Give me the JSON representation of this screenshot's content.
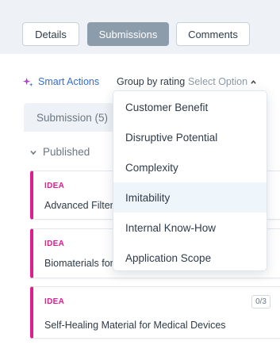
{
  "tabs": [
    {
      "label": "Details"
    },
    {
      "label": "Submissions",
      "active": true
    },
    {
      "label": "Comments"
    }
  ],
  "toolbar": {
    "smart_actions": "Smart Actions",
    "group_label": "Group by rating",
    "group_value": "Select Option"
  },
  "submission_tab": {
    "label": "Submission (5)"
  },
  "section": {
    "label": "Published"
  },
  "cards": [
    {
      "type": "IDEA",
      "title": "Advanced Filteri",
      "count": ""
    },
    {
      "type": "IDEA",
      "title": "Biomaterials for",
      "count": ""
    },
    {
      "type": "IDEA",
      "title": "Self-Healing Material for Medical Devices",
      "count": "0/3"
    }
  ],
  "dropdown": {
    "options": [
      "Customer Benefit",
      "Disruptive Potential",
      "Complexity",
      "Imitability",
      "Internal Know-How",
      "Application Scope"
    ],
    "highlighted": "Imitability"
  },
  "colors": {
    "accent": "#2f6fd6",
    "idea_pink": "#e11c8f",
    "active_tab": "#8d9cab"
  },
  "icons": {
    "smart_actions": "sparkle-icon",
    "select_chevron": "chevron-up-icon",
    "section_chevron": "chevron-down-icon"
  }
}
